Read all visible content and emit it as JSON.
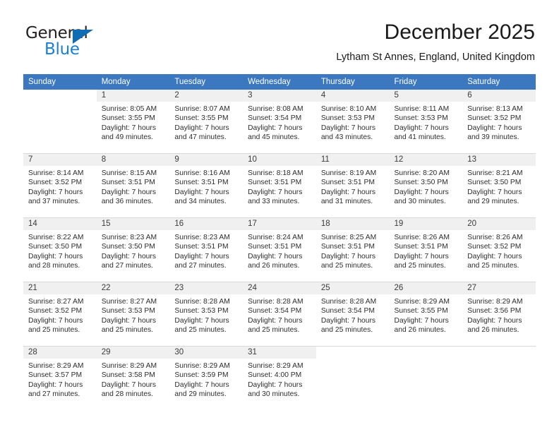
{
  "brand": {
    "name_part1": "General",
    "name_part2": "Blue",
    "triangle_color": "#106cb4",
    "blue_color": "#1b7fd4"
  },
  "header": {
    "month_year": "December 2025",
    "location": "Lytham St Annes, England, United Kingdom"
  },
  "theme": {
    "header_row_bg": "#3b78bf",
    "header_row_text": "#ffffff",
    "daynum_band_bg": "#f0f0f0",
    "grid_line": "#d9d9d9",
    "body_text": "#2d2d2d"
  },
  "calendar": {
    "weekday_headers": [
      "Sunday",
      "Monday",
      "Tuesday",
      "Wednesday",
      "Thursday",
      "Friday",
      "Saturday"
    ],
    "weeks": [
      [
        {
          "day": "",
          "blank": true,
          "sunrise": "",
          "sunset": "",
          "daylight_line1": "",
          "daylight_line2": ""
        },
        {
          "day": "1",
          "sunrise": "Sunrise: 8:05 AM",
          "sunset": "Sunset: 3:55 PM",
          "daylight_line1": "Daylight: 7 hours",
          "daylight_line2": "and 49 minutes."
        },
        {
          "day": "2",
          "sunrise": "Sunrise: 8:07 AM",
          "sunset": "Sunset: 3:55 PM",
          "daylight_line1": "Daylight: 7 hours",
          "daylight_line2": "and 47 minutes."
        },
        {
          "day": "3",
          "sunrise": "Sunrise: 8:08 AM",
          "sunset": "Sunset: 3:54 PM",
          "daylight_line1": "Daylight: 7 hours",
          "daylight_line2": "and 45 minutes."
        },
        {
          "day": "4",
          "sunrise": "Sunrise: 8:10 AM",
          "sunset": "Sunset: 3:53 PM",
          "daylight_line1": "Daylight: 7 hours",
          "daylight_line2": "and 43 minutes."
        },
        {
          "day": "5",
          "sunrise": "Sunrise: 8:11 AM",
          "sunset": "Sunset: 3:53 PM",
          "daylight_line1": "Daylight: 7 hours",
          "daylight_line2": "and 41 minutes."
        },
        {
          "day": "6",
          "sunrise": "Sunrise: 8:13 AM",
          "sunset": "Sunset: 3:52 PM",
          "daylight_line1": "Daylight: 7 hours",
          "daylight_line2": "and 39 minutes."
        }
      ],
      [
        {
          "day": "7",
          "sunrise": "Sunrise: 8:14 AM",
          "sunset": "Sunset: 3:52 PM",
          "daylight_line1": "Daylight: 7 hours",
          "daylight_line2": "and 37 minutes."
        },
        {
          "day": "8",
          "sunrise": "Sunrise: 8:15 AM",
          "sunset": "Sunset: 3:51 PM",
          "daylight_line1": "Daylight: 7 hours",
          "daylight_line2": "and 36 minutes."
        },
        {
          "day": "9",
          "sunrise": "Sunrise: 8:16 AM",
          "sunset": "Sunset: 3:51 PM",
          "daylight_line1": "Daylight: 7 hours",
          "daylight_line2": "and 34 minutes."
        },
        {
          "day": "10",
          "sunrise": "Sunrise: 8:18 AM",
          "sunset": "Sunset: 3:51 PM",
          "daylight_line1": "Daylight: 7 hours",
          "daylight_line2": "and 33 minutes."
        },
        {
          "day": "11",
          "sunrise": "Sunrise: 8:19 AM",
          "sunset": "Sunset: 3:51 PM",
          "daylight_line1": "Daylight: 7 hours",
          "daylight_line2": "and 31 minutes."
        },
        {
          "day": "12",
          "sunrise": "Sunrise: 8:20 AM",
          "sunset": "Sunset: 3:50 PM",
          "daylight_line1": "Daylight: 7 hours",
          "daylight_line2": "and 30 minutes."
        },
        {
          "day": "13",
          "sunrise": "Sunrise: 8:21 AM",
          "sunset": "Sunset: 3:50 PM",
          "daylight_line1": "Daylight: 7 hours",
          "daylight_line2": "and 29 minutes."
        }
      ],
      [
        {
          "day": "14",
          "sunrise": "Sunrise: 8:22 AM",
          "sunset": "Sunset: 3:50 PM",
          "daylight_line1": "Daylight: 7 hours",
          "daylight_line2": "and 28 minutes."
        },
        {
          "day": "15",
          "sunrise": "Sunrise: 8:23 AM",
          "sunset": "Sunset: 3:50 PM",
          "daylight_line1": "Daylight: 7 hours",
          "daylight_line2": "and 27 minutes."
        },
        {
          "day": "16",
          "sunrise": "Sunrise: 8:23 AM",
          "sunset": "Sunset: 3:51 PM",
          "daylight_line1": "Daylight: 7 hours",
          "daylight_line2": "and 27 minutes."
        },
        {
          "day": "17",
          "sunrise": "Sunrise: 8:24 AM",
          "sunset": "Sunset: 3:51 PM",
          "daylight_line1": "Daylight: 7 hours",
          "daylight_line2": "and 26 minutes."
        },
        {
          "day": "18",
          "sunrise": "Sunrise: 8:25 AM",
          "sunset": "Sunset: 3:51 PM",
          "daylight_line1": "Daylight: 7 hours",
          "daylight_line2": "and 25 minutes."
        },
        {
          "day": "19",
          "sunrise": "Sunrise: 8:26 AM",
          "sunset": "Sunset: 3:51 PM",
          "daylight_line1": "Daylight: 7 hours",
          "daylight_line2": "and 25 minutes."
        },
        {
          "day": "20",
          "sunrise": "Sunrise: 8:26 AM",
          "sunset": "Sunset: 3:52 PM",
          "daylight_line1": "Daylight: 7 hours",
          "daylight_line2": "and 25 minutes."
        }
      ],
      [
        {
          "day": "21",
          "sunrise": "Sunrise: 8:27 AM",
          "sunset": "Sunset: 3:52 PM",
          "daylight_line1": "Daylight: 7 hours",
          "daylight_line2": "and 25 minutes."
        },
        {
          "day": "22",
          "sunrise": "Sunrise: 8:27 AM",
          "sunset": "Sunset: 3:53 PM",
          "daylight_line1": "Daylight: 7 hours",
          "daylight_line2": "and 25 minutes."
        },
        {
          "day": "23",
          "sunrise": "Sunrise: 8:28 AM",
          "sunset": "Sunset: 3:53 PM",
          "daylight_line1": "Daylight: 7 hours",
          "daylight_line2": "and 25 minutes."
        },
        {
          "day": "24",
          "sunrise": "Sunrise: 8:28 AM",
          "sunset": "Sunset: 3:54 PM",
          "daylight_line1": "Daylight: 7 hours",
          "daylight_line2": "and 25 minutes."
        },
        {
          "day": "25",
          "sunrise": "Sunrise: 8:28 AM",
          "sunset": "Sunset: 3:54 PM",
          "daylight_line1": "Daylight: 7 hours",
          "daylight_line2": "and 25 minutes."
        },
        {
          "day": "26",
          "sunrise": "Sunrise: 8:29 AM",
          "sunset": "Sunset: 3:55 PM",
          "daylight_line1": "Daylight: 7 hours",
          "daylight_line2": "and 26 minutes."
        },
        {
          "day": "27",
          "sunrise": "Sunrise: 8:29 AM",
          "sunset": "Sunset: 3:56 PM",
          "daylight_line1": "Daylight: 7 hours",
          "daylight_line2": "and 26 minutes."
        }
      ],
      [
        {
          "day": "28",
          "sunrise": "Sunrise: 8:29 AM",
          "sunset": "Sunset: 3:57 PM",
          "daylight_line1": "Daylight: 7 hours",
          "daylight_line2": "and 27 minutes."
        },
        {
          "day": "29",
          "sunrise": "Sunrise: 8:29 AM",
          "sunset": "Sunset: 3:58 PM",
          "daylight_line1": "Daylight: 7 hours",
          "daylight_line2": "and 28 minutes."
        },
        {
          "day": "30",
          "sunrise": "Sunrise: 8:29 AM",
          "sunset": "Sunset: 3:59 PM",
          "daylight_line1": "Daylight: 7 hours",
          "daylight_line2": "and 29 minutes."
        },
        {
          "day": "31",
          "sunrise": "Sunrise: 8:29 AM",
          "sunset": "Sunset: 4:00 PM",
          "daylight_line1": "Daylight: 7 hours",
          "daylight_line2": "and 30 minutes."
        },
        {
          "day": "",
          "blank": true,
          "sunrise": "",
          "sunset": "",
          "daylight_line1": "",
          "daylight_line2": ""
        },
        {
          "day": "",
          "blank": true,
          "sunrise": "",
          "sunset": "",
          "daylight_line1": "",
          "daylight_line2": ""
        },
        {
          "day": "",
          "blank": true,
          "sunrise": "",
          "sunset": "",
          "daylight_line1": "",
          "daylight_line2": ""
        }
      ]
    ]
  }
}
